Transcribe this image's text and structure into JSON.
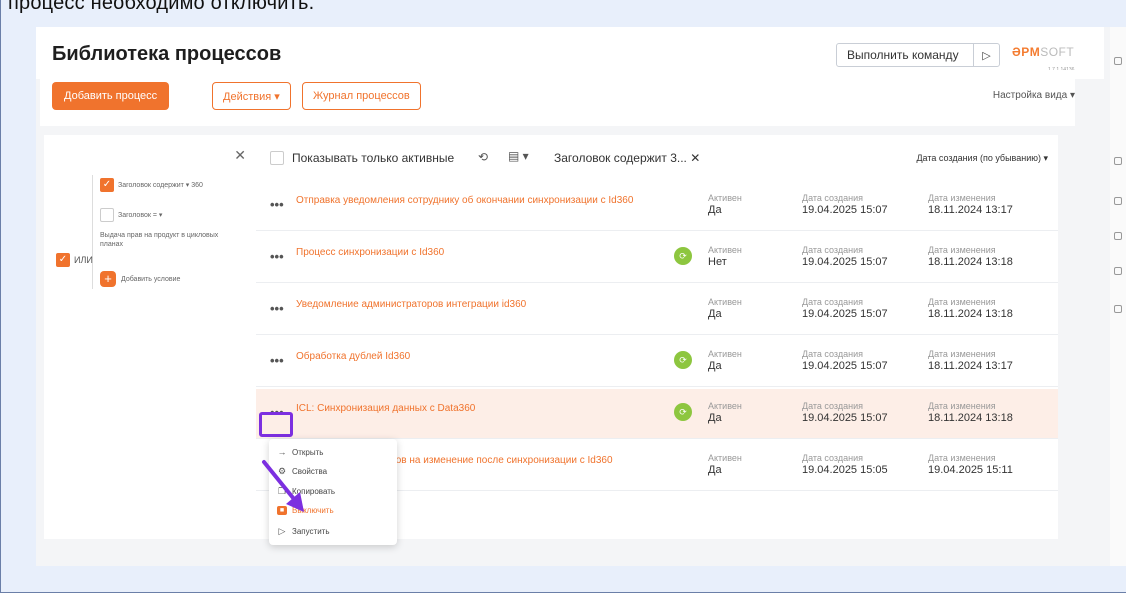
{
  "caption": "процесс необходимо отключить.",
  "header": {
    "title": "Библиотека процессов",
    "command_label": "Выполнить команду",
    "run_icon": "play-icon",
    "logo_main": "ƏPM",
    "logo_soft": "SOFT",
    "version": "1.7.1.14136"
  },
  "toolbar": {
    "add_process": "Добавить процесс",
    "actions": "Действия ▾",
    "journal": "Журнал процессов",
    "view_settings": "Настройка вида ▾"
  },
  "filter": {
    "close": "✕",
    "or_label": "ИЛИ",
    "cond1": "Заголовок  содержит ▾  360",
    "cond2": "Заголовок  = ▾",
    "cond2_sub": "Выдача прав на продукт в цикловых планах",
    "add_condition": "Добавить условие"
  },
  "list_header": {
    "show_active": "Показывать только активные",
    "title_filter": "Заголовок содержит 3... ✕",
    "sort": "Дата создания (по убыванию) ▾"
  },
  "columns": {
    "active": "Активен",
    "created": "Дата создания",
    "modified": "Дата изменения"
  },
  "rows": [
    {
      "name": "Отправка уведомления сотруднику об окончании синхронизации с Id360",
      "active": "Да",
      "created": "19.04.2025 15:07",
      "modified": "18.11.2024 13:17",
      "sync": false
    },
    {
      "name": "Процесс синхронизации с Id360",
      "active": "Нет",
      "created": "19.04.2025 15:07",
      "modified": "18.11.2024 13:18",
      "sync": true
    },
    {
      "name": "Уведомление администраторов интеграции id360",
      "active": "Да",
      "created": "19.04.2025 15:07",
      "modified": "18.11.2024 13:18",
      "sync": false
    },
    {
      "name": "Обработка дублей Id360",
      "active": "Да",
      "created": "19.04.2025 15:07",
      "modified": "18.11.2024 13:17",
      "sync": true
    },
    {
      "name": "ICL: Синхронизация данных с Data360",
      "active": "Да",
      "created": "19.04.2025 15:07",
      "modified": "18.11.2024 13:18",
      "sync": true
    },
    {
      "name": "нение данных запросов на изменение после синхронизации с Id360",
      "active": "Да",
      "created": "19.04.2025 15:05",
      "modified": "19.04.2025 15:11",
      "sync": false
    }
  ],
  "context_menu": {
    "open": "Открыть",
    "properties": "Свойства",
    "copy": "Копировать",
    "disable": "Выключить",
    "run": "Запустить"
  },
  "colors": {
    "accent": "#f0732d",
    "highlight": "#7c2fe0",
    "sync": "#8dc63f",
    "selected_row": "#fdeee7"
  }
}
